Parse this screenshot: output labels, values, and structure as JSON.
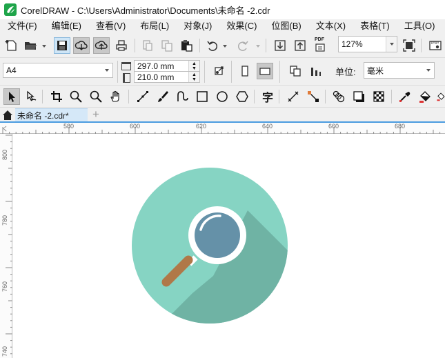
{
  "window": {
    "title": "CorelDRAW - C:\\Users\\Administrator\\Documents\\未命名 -2.cdr",
    "app_logo": "coreldraw-logo"
  },
  "menu": [
    {
      "label": "文件(F)"
    },
    {
      "label": "编辑(E)"
    },
    {
      "label": "查看(V)"
    },
    {
      "label": "布局(L)"
    },
    {
      "label": "对象(J)"
    },
    {
      "label": "效果(C)"
    },
    {
      "label": "位图(B)"
    },
    {
      "label": "文本(X)"
    },
    {
      "label": "表格(T)"
    },
    {
      "label": "工具(O)"
    }
  ],
  "standard_toolbar": {
    "zoom_value": "127%",
    "pdf_label": "PDF"
  },
  "property_bar": {
    "page_size": "A4",
    "width_value": "297.0 mm",
    "height_value": "210.0 mm",
    "units_label": "单位:",
    "units_value": "毫米"
  },
  "document_tab": {
    "label": "未命名 -2.cdr*",
    "add_tab_icon": "plus-icon"
  },
  "ruler": {
    "horizontal_labels": [
      "580",
      "600",
      "620",
      "640",
      "660",
      "680"
    ],
    "vertical_labels": [
      "800",
      "780",
      "760",
      "740"
    ],
    "corner_label": "く"
  },
  "illustration": {
    "name": "magnifier-flat-icon",
    "circle_color": "#86d4c3",
    "shadow_color": "#6fb3a4",
    "ring_color": "#ffffff",
    "lens_color": "#6591a8",
    "handle_color": "#b07848"
  }
}
